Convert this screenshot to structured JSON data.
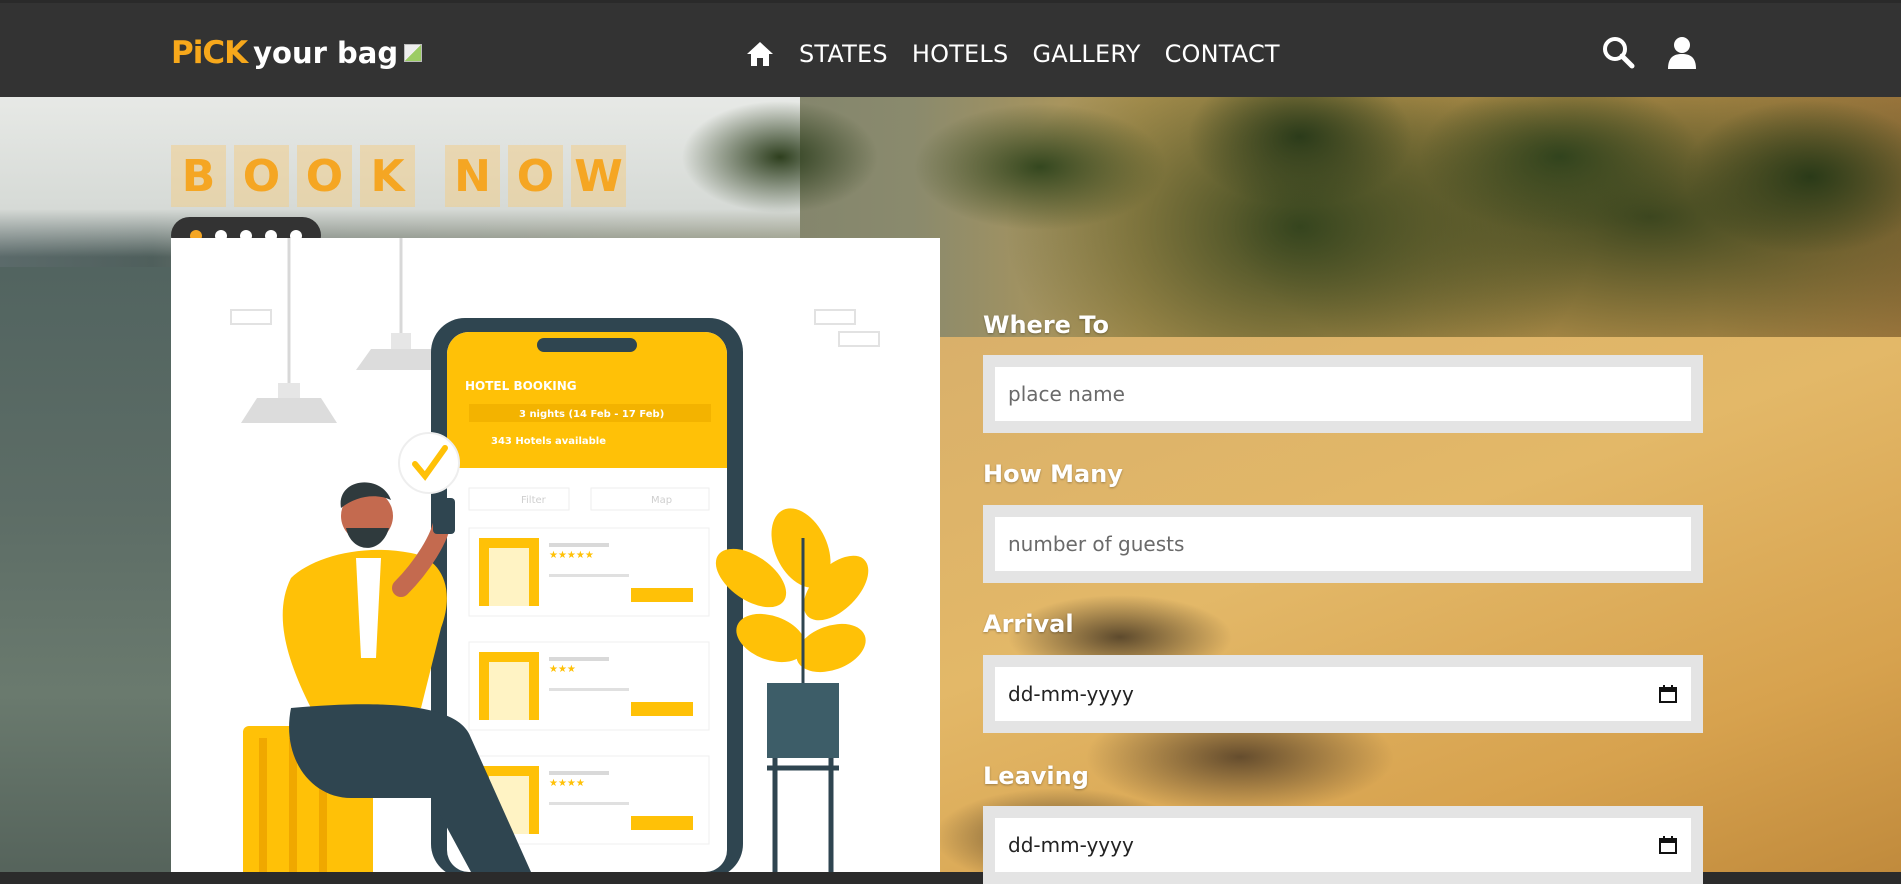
{
  "header": {
    "logo": {
      "pick": "PiCK",
      "rest": "your bag"
    },
    "nav": [
      {
        "label": "STATES"
      },
      {
        "label": "HOTELS"
      },
      {
        "label": "GALLERY"
      },
      {
        "label": "CONTACT"
      }
    ],
    "icons": [
      "home-icon",
      "search-icon",
      "user-icon"
    ]
  },
  "hero": {
    "title_word1": [
      "B",
      "O",
      "O",
      "K"
    ],
    "title_word2": [
      "N",
      "O",
      "W"
    ],
    "carousel": {
      "count": 5,
      "active": 0
    },
    "illustration": {
      "heading": "HOTEL BOOKING",
      "dates": "3 nights (14 Feb - 17 Feb)",
      "available": "343 Hotels available",
      "filter": "Filter",
      "map": "Map"
    }
  },
  "form": {
    "where": {
      "label": "Where To",
      "placeholder": "place name"
    },
    "how_many": {
      "label": "How Many",
      "placeholder": "number of guests"
    },
    "arrival": {
      "label": "Arrival",
      "value": "dd-mm-yyyy"
    },
    "leaving": {
      "label": "Leaving",
      "value": "dd-mm-yyyy"
    }
  },
  "colors": {
    "accent": "#f5a623",
    "header_bg": "#333333",
    "field_frame": "#e4e4e4"
  }
}
